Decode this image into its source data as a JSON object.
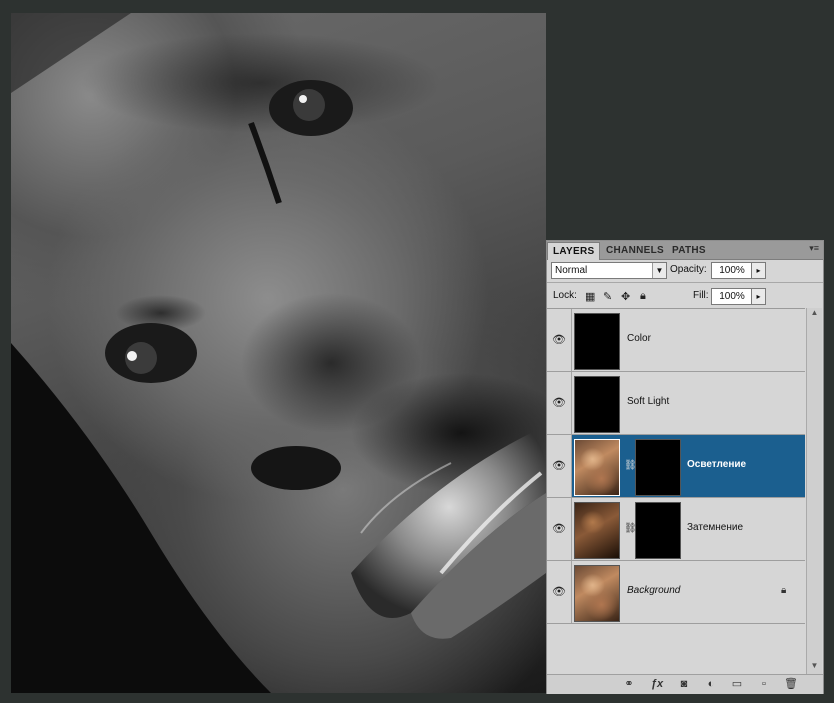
{
  "panel": {
    "tabs": [
      {
        "label": "LAYERS",
        "active": true
      },
      {
        "label": "CHANNELS",
        "active": false
      },
      {
        "label": "PATHS",
        "active": false
      }
    ],
    "blend_mode": "Normal",
    "opacity_label": "Opacity:",
    "opacity_value": "100%",
    "lock_label": "Lock:",
    "fill_label": "Fill:",
    "fill_value": "100%"
  },
  "layers": [
    {
      "name": "Color",
      "thumb": "black",
      "mask": false,
      "selected": false,
      "italic": false,
      "locked": false,
      "visible": true
    },
    {
      "name": "Soft Light",
      "thumb": "black",
      "mask": false,
      "selected": false,
      "italic": false,
      "locked": false,
      "visible": true
    },
    {
      "name": "Осветление",
      "thumb": "photo",
      "mask": true,
      "selected": true,
      "italic": false,
      "locked": false,
      "visible": true
    },
    {
      "name": "Затемнение",
      "thumb": "photo-dark",
      "mask": true,
      "selected": false,
      "italic": false,
      "locked": false,
      "visible": true
    },
    {
      "name": "Background",
      "thumb": "photo",
      "mask": false,
      "selected": false,
      "italic": true,
      "locked": true,
      "visible": true
    }
  ],
  "bottom_tools": [
    "link-layers-icon",
    "fx-icon",
    "add-mask-icon",
    "adjustment-layer-icon",
    "new-group-icon",
    "new-layer-icon",
    "trash-icon"
  ],
  "colors": {
    "selected_row": "#1b5f8f",
    "panel_bg": "#d6d6d6",
    "workspace_bg": "#2d3230"
  }
}
